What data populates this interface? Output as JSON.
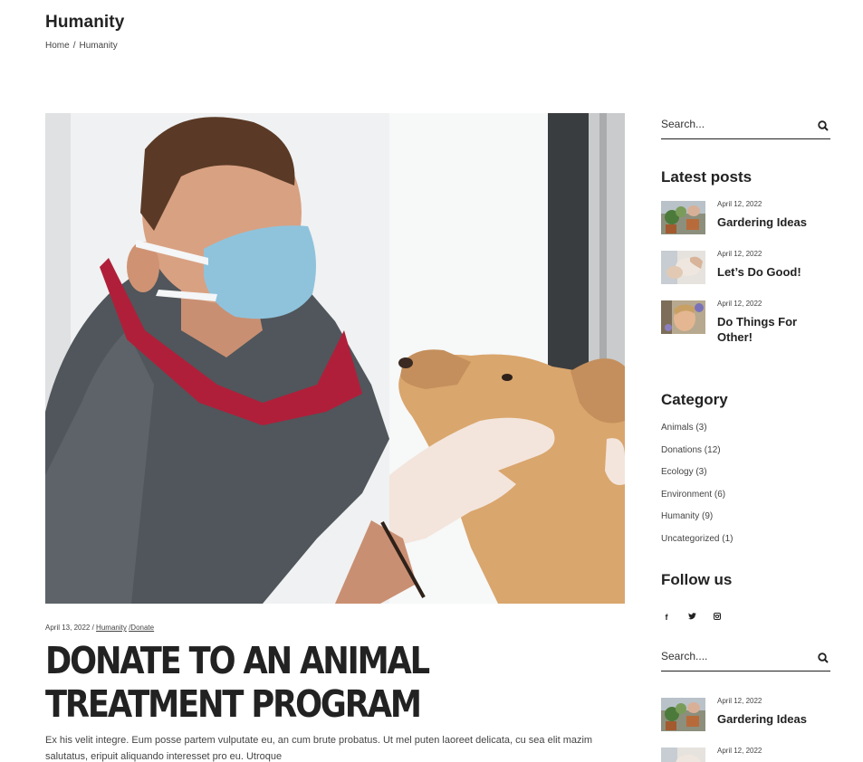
{
  "header": {
    "title": "Humanity",
    "breadcrumb": {
      "home": "Home",
      "separator": "/",
      "current": "Humanity"
    }
  },
  "post": {
    "date": "April 13, 2022",
    "date_separator": " / ",
    "categories": [
      "Humanity",
      "/Donate"
    ],
    "title": "DONATE TO AN ANIMAL TREATMENT PROGRAM",
    "excerpt": "Ex his velit integre. Eum posse partem vulputate eu, an cum brute probatus. Ut mel puten laoreet delicata, cu sea elit mazim salutatus, eripuit aliquando interesset pro eu. Utroque"
  },
  "sidebar": {
    "search_placeholder": "Search...",
    "latest_title": "Latest posts",
    "latest_posts": [
      {
        "date": "April 12, 2022",
        "title": "Gardering Ideas",
        "thumb": "gardening"
      },
      {
        "date": "April 12, 2022",
        "title": "Let’s Do Good!",
        "thumb": "doing-good"
      },
      {
        "date": "April 12, 2022",
        "title": "Do Things For Other!",
        "thumb": "portrait"
      }
    ],
    "category_title": "Category",
    "categories": [
      "Animals (3)",
      "Donations (12)",
      "Ecology (3)",
      "Environment (6)",
      "Humanity (9)",
      "Uncategorized (1)"
    ],
    "follow_title": "Follow us",
    "social": [
      {
        "icon": "facebook-icon",
        "glyph": "f"
      },
      {
        "icon": "twitter-icon",
        "glyph": "🐦"
      },
      {
        "icon": "instagram-icon",
        "glyph": "◙"
      }
    ],
    "search2_placeholder": "Search....",
    "latest_posts_2": [
      {
        "date": "April 12, 2022",
        "title": "Gardering Ideas"
      },
      {
        "date": "April 12, 2022",
        "title": ""
      }
    ]
  },
  "colors": {
    "text": "#222222",
    "muted": "#444444",
    "background": "#ffffff"
  }
}
